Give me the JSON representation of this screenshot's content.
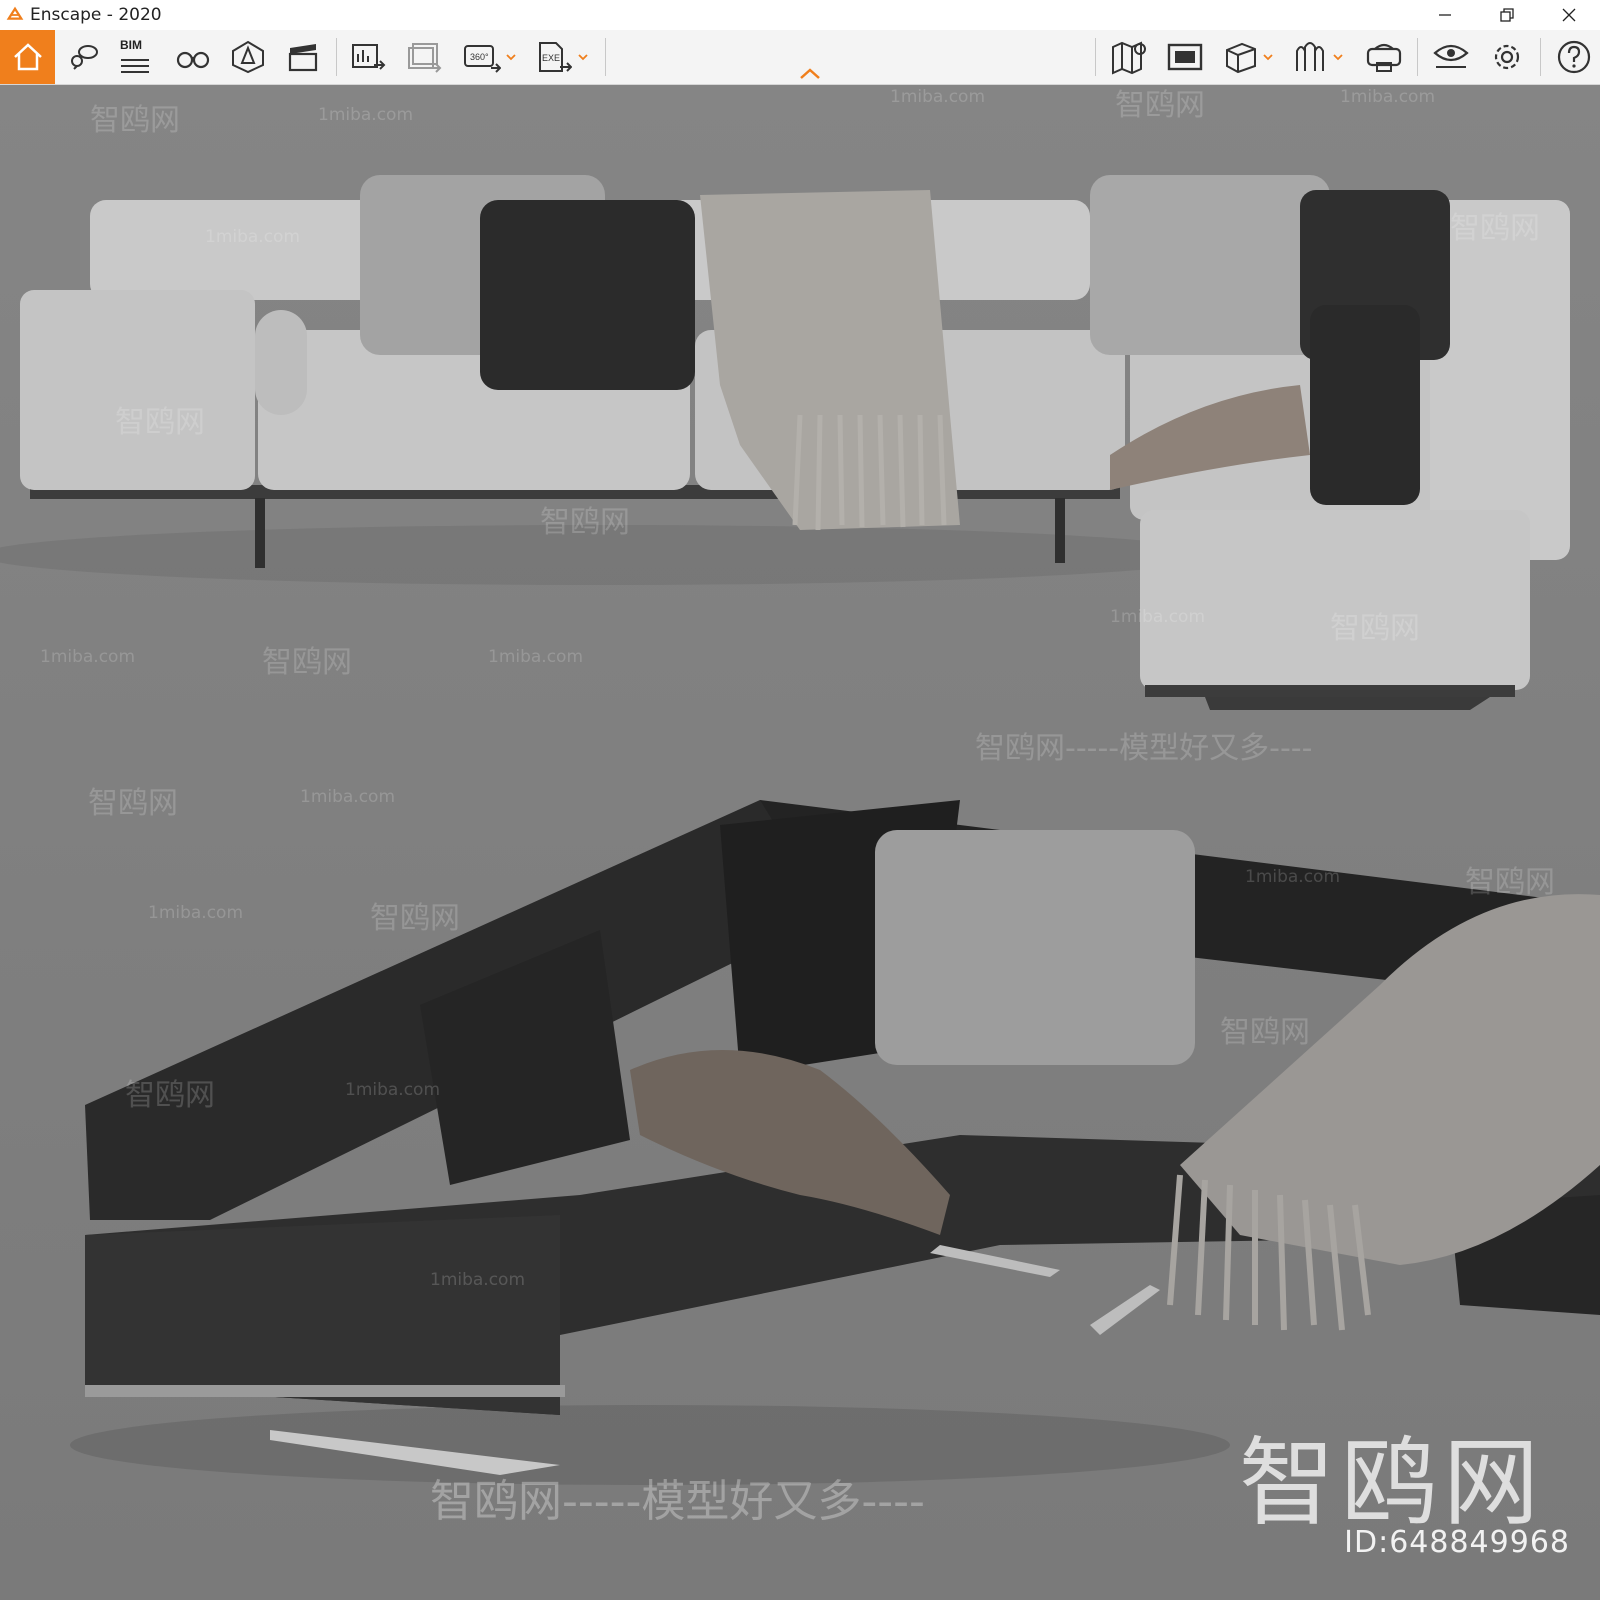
{
  "window": {
    "title": "Enscape - 2020",
    "brand_color": "#f07f1c",
    "controls": [
      "minimize-icon",
      "restore-icon",
      "close-icon"
    ]
  },
  "toolbar": {
    "bim_label": "BIM",
    "left_group": [
      "home-icon",
      "pin-speech-icon",
      "bim-list-icon",
      "binoculars-icon",
      "light-view-icon",
      "clapperboard-icon"
    ],
    "export_group": [
      "render-export-icon",
      "batch-render-icon",
      "panorama-360-icon",
      "exe-export-icon"
    ],
    "right_group": [
      "map-icon",
      "screenshot-icon",
      "cube-icon",
      "asset-library-icon",
      "vr-headset-icon",
      "visual-settings-icon",
      "gear-icon",
      "help-icon"
    ]
  },
  "viewport": {
    "scene": "sectional-sofa-renders",
    "watermarks": {
      "site_cn": "智鸥网",
      "site_url": "1miba.com",
      "tagline": "智鸥网-----模型好又多----",
      "brand_big": "智鸥网",
      "id_text": "ID:648849968"
    }
  }
}
